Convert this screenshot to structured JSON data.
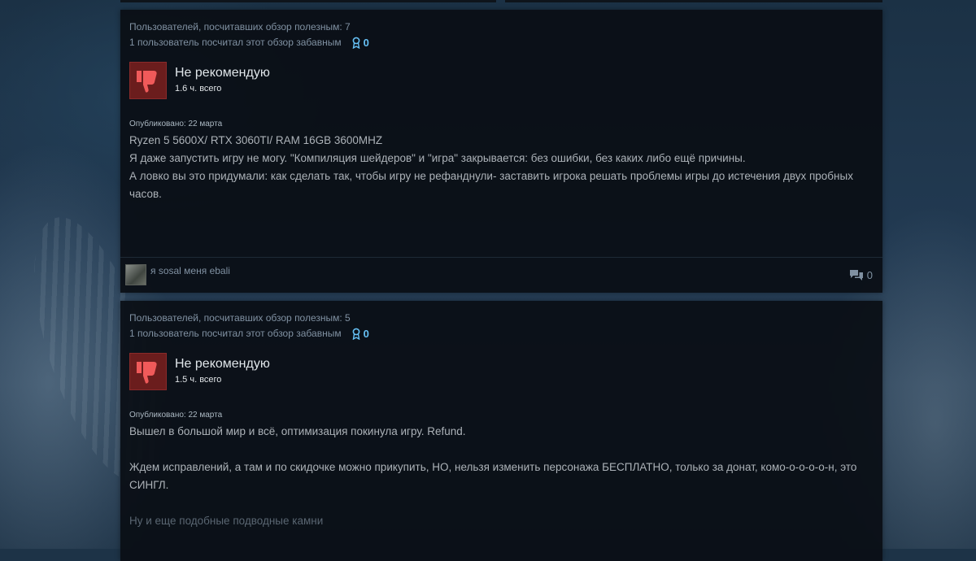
{
  "reviews": [
    {
      "helpful_text": "Пользователей, посчитавших обзор полезным: 7",
      "funny_text": "1 пользователь посчитал этот обзор забавным",
      "awards_count": "0",
      "verdict": "Не рекомендую",
      "hours": "1.6 ч. всего",
      "posted": "Опубликовано: 22 марта",
      "body": [
        "Ryzen 5 5600X/ RTX 3060TI/ RAM 16GB 3600MHZ",
        "Я даже запустить игру не могу. \"Компиляция шейдеров\" и \"игра\" закрывается: без ошибки, без каких либо ещё причины.",
        "А ловко вы это придумали: как сделать так, чтобы игру не рефанднули- заставить игрока решать проблемы игры до истечения двух пробных часов."
      ],
      "author": "я sosal меня ebali",
      "comments_count": "0"
    },
    {
      "helpful_text": "Пользователей, посчитавших обзор полезным: 5",
      "funny_text": "1 пользователь посчитал этот обзор забавным",
      "awards_count": "0",
      "verdict": "Не рекомендую",
      "hours": "1.5 ч. всего",
      "posted": "Опубликовано: 22 марта",
      "body": [
        "Вышел в большой мир и всё, оптимизация покинула игру. Refund.",
        "Ждем исправлений, а там и по скидочке можно прикупить, НО, нельзя изменить персонажа БЕСПЛАТНО, только за донат, комо-о-о-о-о-н, это СИНГЛ.",
        "Ну и еще подобные подводные камни"
      ]
    }
  ],
  "icons": {
    "award": "award-icon",
    "thumbs_down": "thumbs-down-icon",
    "comment": "comment-icon",
    "avatar": "avatar"
  },
  "colors": {
    "award_blue": "#66c0f4",
    "thumb_red": "#6b1d1d",
    "panel_bg": "#0a0e14"
  }
}
